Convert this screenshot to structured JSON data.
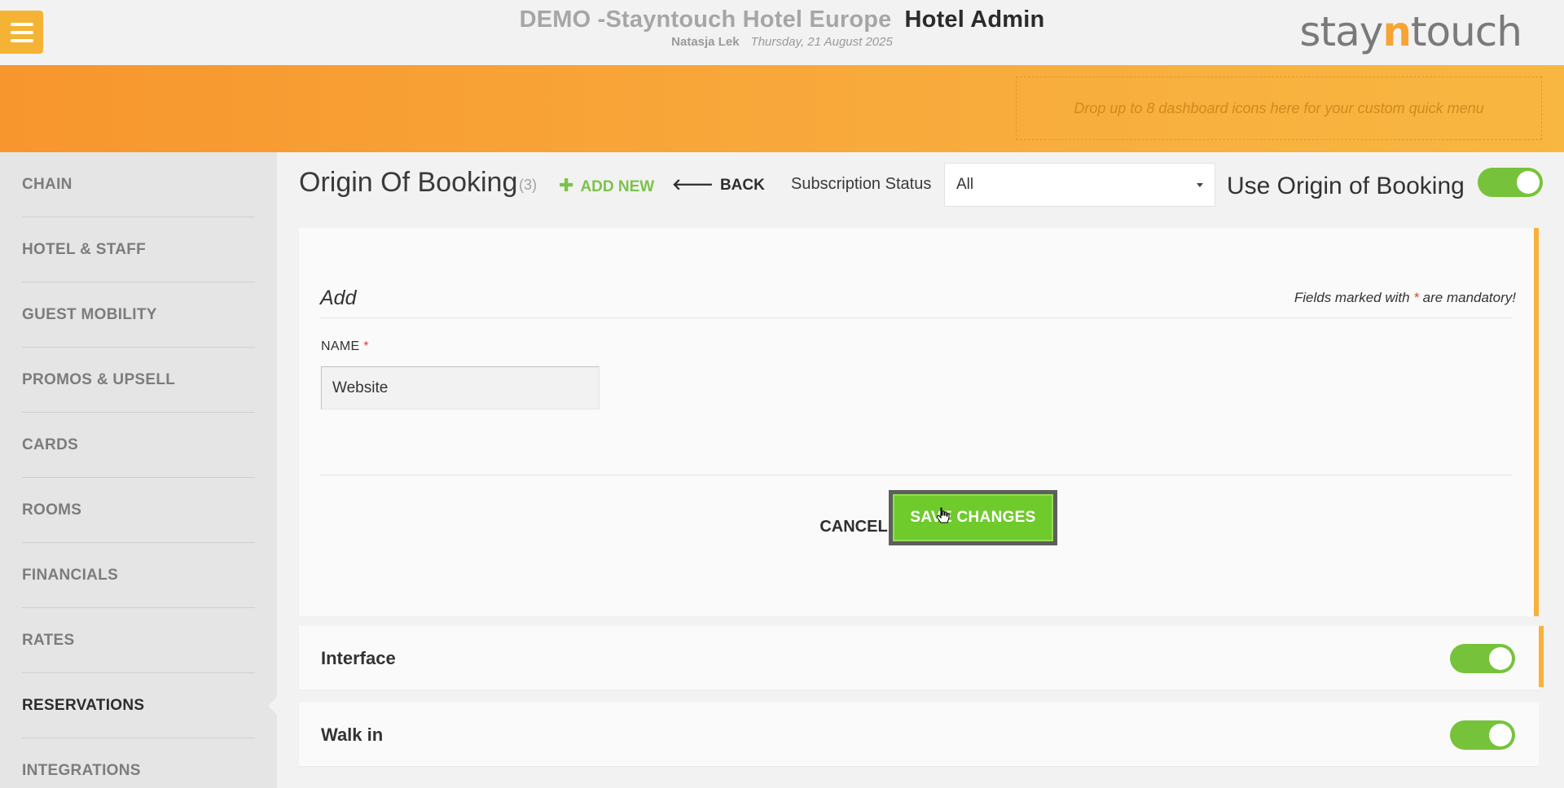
{
  "header": {
    "hotel_name": "DEMO -Stayntouch Hotel Europe",
    "app_name": "Hotel Admin",
    "user": "Natasja Lek",
    "date": "Thursday, 21 August 2025",
    "logo": {
      "before": "stay",
      "accent": "n",
      "after": "touch"
    },
    "menu_icon": "hamburger-icon"
  },
  "quick_menu": {
    "placeholder": "Drop up to 8 dashboard icons here for your custom quick menu"
  },
  "sidebar": {
    "items": [
      {
        "label": "CHAIN",
        "active": false
      },
      {
        "label": "HOTEL & STAFF",
        "active": false
      },
      {
        "label": "GUEST MOBILITY",
        "active": false
      },
      {
        "label": "PROMOS & UPSELL",
        "active": false
      },
      {
        "label": "CARDS",
        "active": false
      },
      {
        "label": "ROOMS",
        "active": false
      },
      {
        "label": "FINANCIALS",
        "active": false
      },
      {
        "label": "RATES",
        "active": false
      },
      {
        "label": "RESERVATIONS",
        "active": true
      },
      {
        "label": "INTEGRATIONS",
        "active": false
      }
    ]
  },
  "page": {
    "title": "Origin Of Booking",
    "count": "(3)",
    "add_new_label": "ADD NEW",
    "back_label": "BACK",
    "subscription_label": "Subscription Status",
    "subscription_value": "All",
    "use_origin_label": "Use Origin of Booking",
    "use_origin_enabled": true
  },
  "form": {
    "title": "Add",
    "mandatory_prefix": "Fields marked with",
    "mandatory_star": "*",
    "mandatory_suffix": "are mandatory!",
    "name_label": "NAME",
    "name_star": "*",
    "name_value": "Website",
    "cancel_label": "CANCEL",
    "save_label": "SAVE CHANGES"
  },
  "rows": [
    {
      "label": "Interface",
      "enabled": true
    },
    {
      "label": "Walk in",
      "enabled": true
    }
  ],
  "colors": {
    "accent_orange": "#f7962d",
    "toggle_green": "#76c33b",
    "save_green": "#6fca2c",
    "add_new_green": "#7cc24a"
  }
}
